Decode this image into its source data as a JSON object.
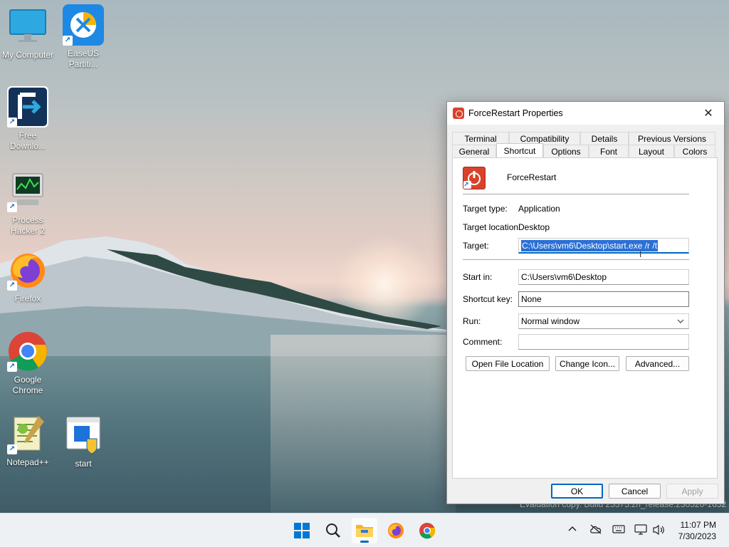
{
  "desktop": {
    "icons": [
      {
        "label": "My Computer"
      },
      {
        "label": "EaseUS Partiti..."
      },
      {
        "label": "Free Downlo..."
      },
      {
        "label": "Process Hacker 2"
      },
      {
        "label": "Firefox"
      },
      {
        "label": "Google Chrome"
      },
      {
        "label": "Notepad++"
      },
      {
        "label": "start"
      }
    ],
    "watermark": "Evaluation copy. Build 25375.zn_release.230520-1652"
  },
  "dialog": {
    "title": "ForceRestart Properties",
    "close_glyph": "✕",
    "tabs_row1": [
      "Terminal",
      "Compatibility",
      "Details",
      "Previous Versions"
    ],
    "tabs_row2": [
      "General",
      "Shortcut",
      "Options",
      "Font",
      "Layout",
      "Colors"
    ],
    "active_tab": "Shortcut",
    "shortcut_name": "ForceRestart",
    "target_type_label": "Target type:",
    "target_type_value": "Application",
    "target_location_label": "Target location:",
    "target_location_value": "Desktop",
    "target_label": "Target:",
    "target_value": "C:\\Users\\vm6\\Desktop\\start.exe /r /t",
    "start_in_label": "Start in:",
    "start_in_value": "C:\\Users\\vm6\\Desktop",
    "shortcut_key_label": "Shortcut key:",
    "shortcut_key_value": "None",
    "run_label": "Run:",
    "run_value": "Normal window",
    "comment_label": "Comment:",
    "comment_value": "",
    "buttons": {
      "open_file_location": "Open File Location",
      "change_icon": "Change Icon...",
      "advanced": "Advanced...",
      "ok": "OK",
      "cancel": "Cancel",
      "apply": "Apply"
    }
  },
  "taskbar": {
    "time": "11:07 PM",
    "date": "7/30/2023"
  },
  "colors": {
    "accent": "#0067c0",
    "selection": "#2a70d6"
  }
}
